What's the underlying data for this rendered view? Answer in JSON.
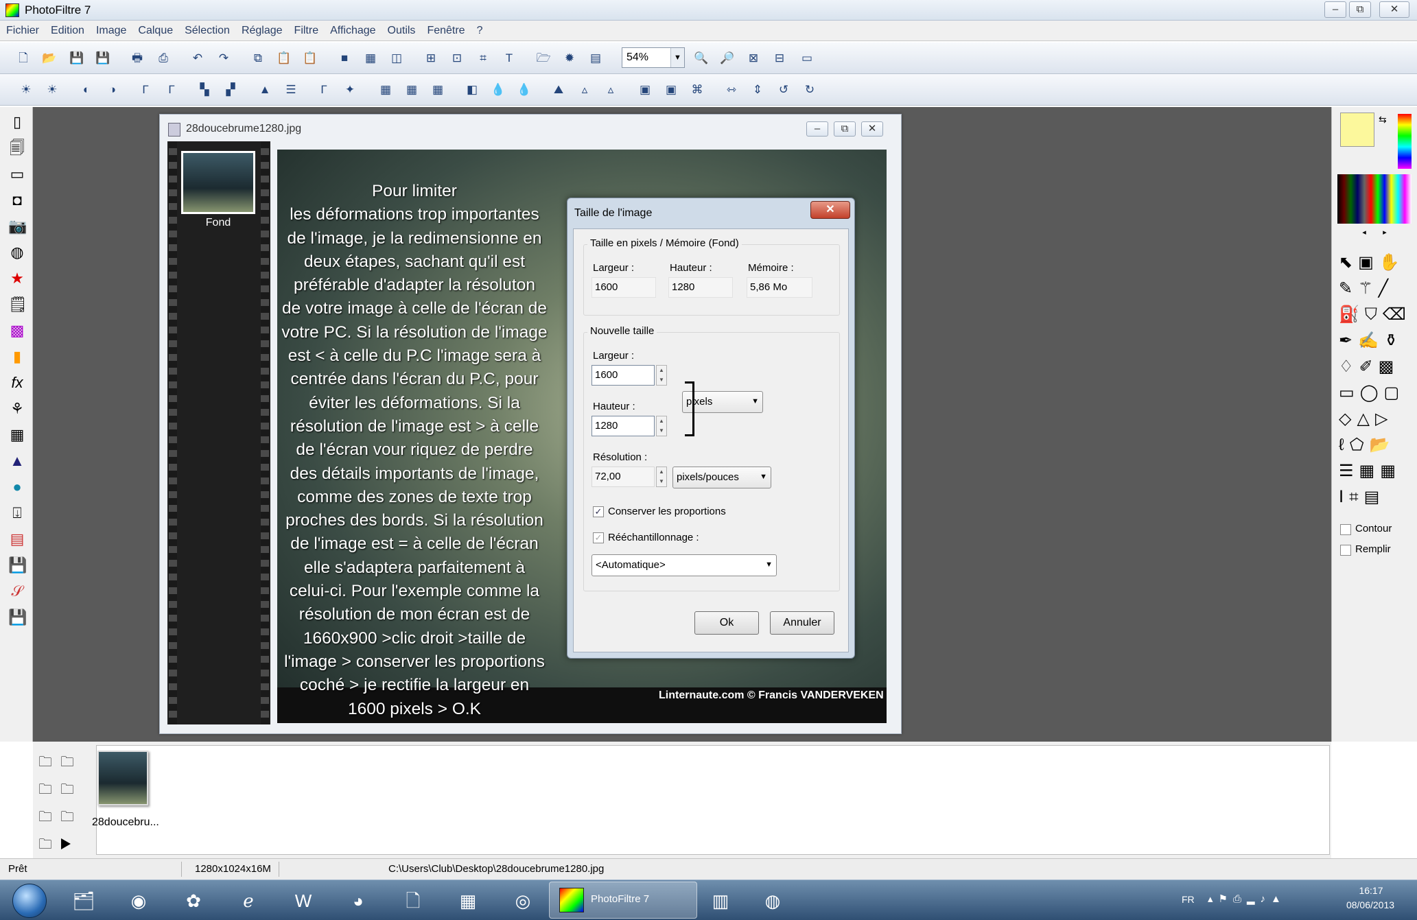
{
  "app": {
    "title": "PhotoFiltre 7"
  },
  "window_controls": {
    "minimize": "–",
    "restore": "⧉",
    "close": "✕"
  },
  "menu": [
    "Fichier",
    "Edition",
    "Image",
    "Calque",
    "Sélection",
    "Réglage",
    "Filtre",
    "Affichage",
    "Outils",
    "Fenêtre",
    "?"
  ],
  "toolbar": {
    "zoom_value": "54%"
  },
  "document": {
    "title": "28doucebrume1280.jpg",
    "layer_label": "Fond",
    "photo_text": "Pour limiter\nles déformations trop importantes\nde l'image, je la redimensionne en\ndeux étapes, sachant qu'il est\npréférable d'adapter la résoluton\nde votre image à celle de l'écran de\nvotre PC. Si la résolution de l'image\nest < à celle du P.C l'image sera à\ncentrée dans l'écran du P.C, pour\néviter les déformations. Si la\nrésolution de l'image est > à celle\nde l'écran vour riquez de perdre\ndes détails importants de l'image,\ncomme des zones de texte trop\nproches des bords. Si la résolution\nde l'image est = à celle de l'écran\nelle s'adaptera parfaitement à\ncelui-ci. Pour l'exemple comme la\nrésolution de mon écran est de\n1660x900 >clic droit >taille de\nl'image > conserver les proportions\ncoché > je rectifie la largeur en\n1600 pixels > O.K",
    "copyright": "Linternaute.com © Francis VANDERVEKEN"
  },
  "dialog": {
    "title": "Taille de l'image",
    "close": "✕",
    "group1": {
      "label": "Taille en pixels / Mémoire (Fond)",
      "width_label": "Largeur :",
      "width_value": "1600",
      "height_label": "Hauteur :",
      "height_value": "1280",
      "memory_label": "Mémoire :",
      "memory_value": "5,86 Mo"
    },
    "group2": {
      "label": "Nouvelle taille",
      "width_label": "Largeur :",
      "width_value": "1600",
      "height_label": "Hauteur :",
      "height_value": "1280",
      "unit_value": "pixels",
      "resolution_label": "Résolution :",
      "resolution_value": "72,00",
      "resolution_unit": "pixels/pouces",
      "keep_proportions_label": "Conserver les proportions",
      "keep_proportions_checked": true,
      "resample_label": "Rééchantillonnage :",
      "resample_checked": true,
      "resample_value": "<Automatique>"
    },
    "ok": "Ok",
    "cancel": "Annuler"
  },
  "right_panel": {
    "contour_label": "Contour",
    "remplir_label": "Remplir"
  },
  "bottom": {
    "thumb_label": "28doucebru..."
  },
  "status": {
    "ready": "Prêt",
    "dimensions": "1280x1024x16M",
    "path": "C:\\Users\\Club\\Desktop\\28doucebrume1280.jpg"
  },
  "taskbar": {
    "active_app": "PhotoFiltre 7",
    "lang": "FR",
    "time": "16:17",
    "date": "08/06/2013"
  }
}
